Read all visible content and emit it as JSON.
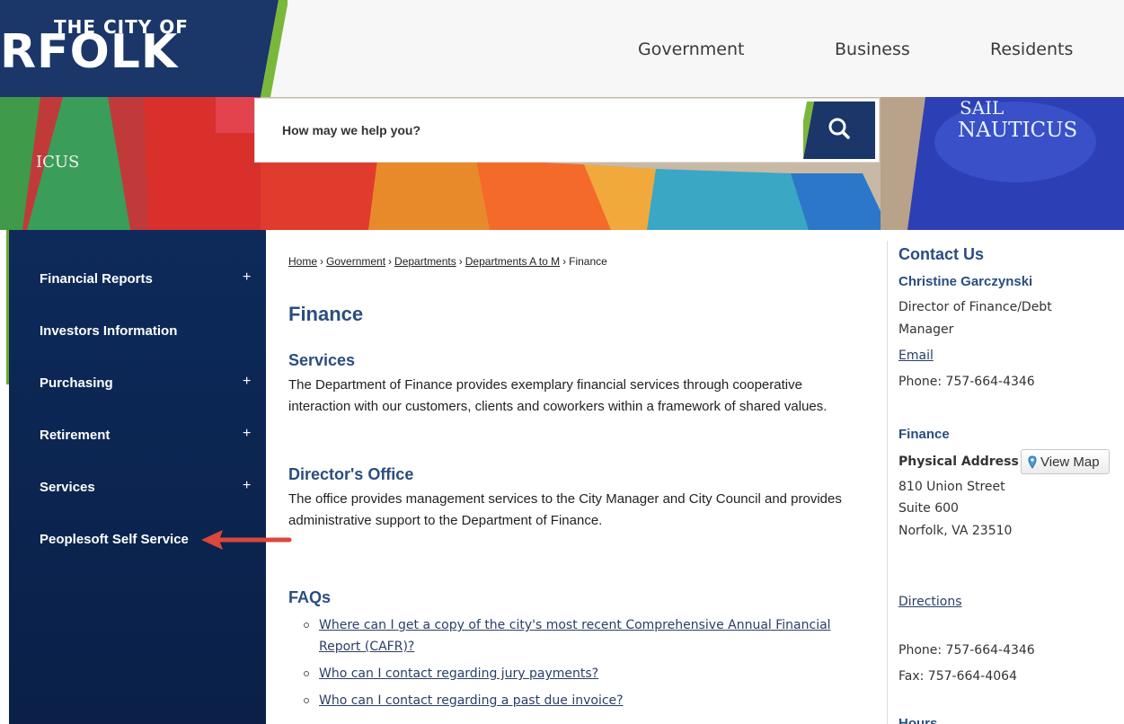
{
  "header": {
    "logo_small": "THE CITY OF",
    "logo_big": "RFOLK",
    "logo_colors": {
      "background": "#1b3668",
      "stripe": "#7ab83c"
    },
    "nav": [
      {
        "label": "Government"
      },
      {
        "label": "Business"
      },
      {
        "label": "Residents"
      }
    ]
  },
  "banner": {
    "sail_text_1": "SAIL",
    "sail_text_2": "NAUTICUS",
    "sail_text_3": "ICUS"
  },
  "search": {
    "placeholder": "How may we help you?",
    "icon": "search-icon"
  },
  "sidebar": {
    "items": [
      {
        "label": "Financial Reports",
        "expandable": "+"
      },
      {
        "label": "Investors Information",
        "expandable": ""
      },
      {
        "label": "Purchasing",
        "expandable": "+"
      },
      {
        "label": "Retirement",
        "expandable": "+"
      },
      {
        "label": "Services",
        "expandable": "+"
      },
      {
        "label": "Peoplesoft Self Service",
        "expandable": ""
      }
    ]
  },
  "breadcrumb": {
    "items": [
      "Home",
      "Government",
      "Departments",
      "Departments A to M",
      "Finance"
    ],
    "separator": "›"
  },
  "main": {
    "title": "Finance",
    "services_heading": "Services",
    "services_text": "The Department of Finance provides exemplary financial services through cooperative interaction with our customers, clients and coworkers within a framework of shared values.",
    "director_heading": "Director's Office",
    "director_text": "The office provides management services to the City Manager and City Council and provides administrative support to the Department of Finance.",
    "faqs_heading": "FAQs",
    "faqs": [
      "Where can I get a copy of the city's most recent Comprehensive Annual Financial Report (CAFR)?",
      "Who can I contact regarding jury payments?",
      "Who can I contact regarding a past due invoice?"
    ]
  },
  "contact": {
    "heading": "Contact Us",
    "name": "Christine Garczynski",
    "title_line1": "Director of Finance/Debt",
    "title_line2": "Manager",
    "email_link": "Email",
    "phone1": "Phone: 757-664-4346",
    "dept": "Finance",
    "address_label": "Physical Address",
    "view_map": "View Map",
    "address1": "810 Union Street",
    "address2": "Suite 600",
    "address3": "Norfolk, VA 23510",
    "directions": "Directions",
    "phone2": "Phone: 757-664-4346",
    "fax": "Fax: 757-664-4064",
    "hours_partial": "Hours"
  },
  "colors": {
    "sidebar_bg": "#0d2a5a",
    "heading": "#2b4d7e",
    "arrow": "#d9483b"
  }
}
